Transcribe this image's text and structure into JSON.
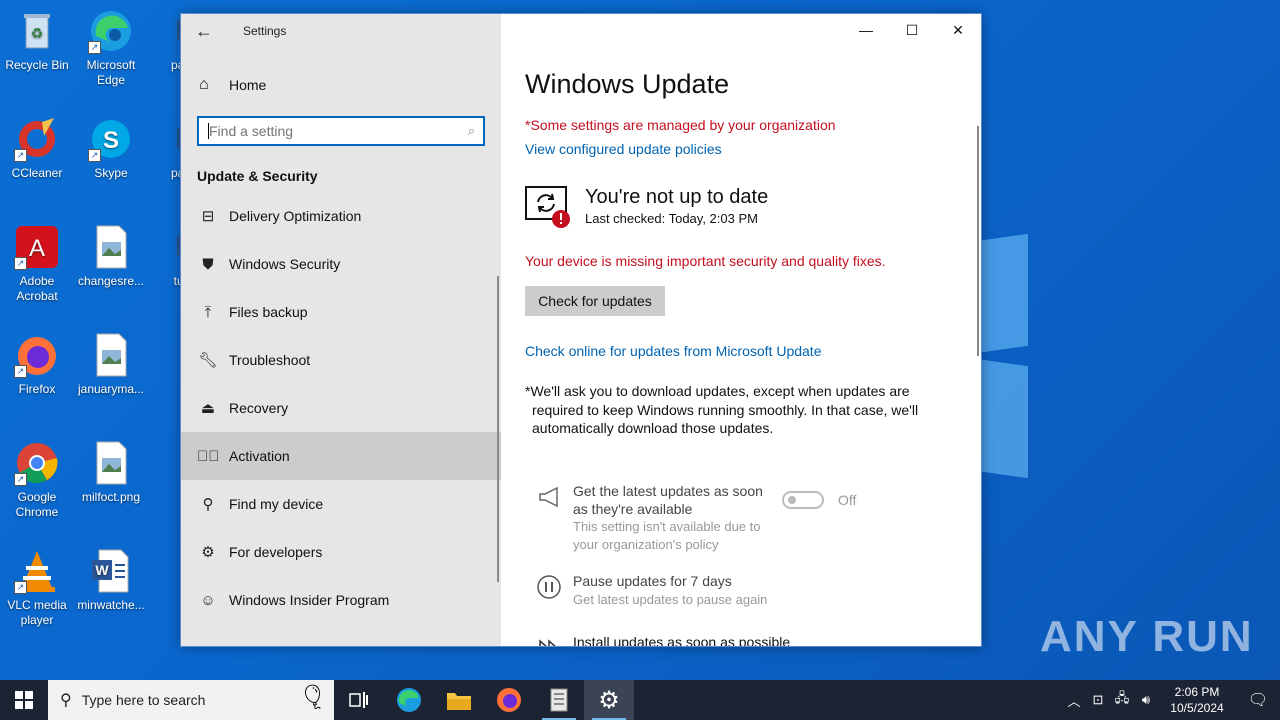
{
  "desktop": {
    "icons": [
      {
        "label": "Recycle Bin"
      },
      {
        "label": "Microsoft Edge"
      },
      {
        "label": "palm"
      },
      {
        "label": "CCleaner"
      },
      {
        "label": "Skype"
      },
      {
        "label": "patie"
      },
      {
        "label": "Adobe Acrobat"
      },
      {
        "label": "changesre..."
      },
      {
        "label": "turn"
      },
      {
        "label": "Firefox"
      },
      {
        "label": "januaryma..."
      },
      {
        "label": "Google Chrome"
      },
      {
        "label": "milfoct.png"
      },
      {
        "label": "VLC media player"
      },
      {
        "label": "minwatche..."
      }
    ],
    "watermark": "ANY RUN"
  },
  "window": {
    "title": "Settings",
    "nav": {
      "home_label": "Home",
      "search_placeholder": "Find a setting",
      "section_title": "Update & Security",
      "items": [
        {
          "label": "Delivery Optimization",
          "icon": "delivery-icon"
        },
        {
          "label": "Windows Security",
          "icon": "shield-icon"
        },
        {
          "label": "Files backup",
          "icon": "backup-icon"
        },
        {
          "label": "Troubleshoot",
          "icon": "wrench-icon"
        },
        {
          "label": "Recovery",
          "icon": "recovery-icon"
        },
        {
          "label": "Activation",
          "icon": "check-circle-icon",
          "selected": true
        },
        {
          "label": "Find my device",
          "icon": "person-pin-icon"
        },
        {
          "label": "For developers",
          "icon": "developer-icon"
        },
        {
          "label": "Windows Insider Program",
          "icon": "insider-icon"
        }
      ]
    },
    "content": {
      "title": "Windows Update",
      "managed_notice": "*Some settings are managed by your organization",
      "view_policies_link": "View configured update policies",
      "status_title": "You're not up to date",
      "status_last_checked": "Last checked: Today, 2:03 PM",
      "warning": "Your device is missing important security and quality fixes.",
      "check_button": "Check for updates",
      "online_link": "Check online for updates from Microsoft Update",
      "note_line1": "*We'll ask you to download updates, except when updates are",
      "note_line2": "required to keep Windows running smoothly. In that case, we'll",
      "note_line3": "automatically download those updates.",
      "option_latest_title_1": "Get the latest updates as soon",
      "option_latest_title_2": "as they're available",
      "option_latest_sub_1": "This setting isn't available due to",
      "option_latest_sub_2": "your organization's policy",
      "toggle_state": "Off",
      "option_pause_title": "Pause updates for 7 days",
      "option_pause_sub": "Get latest updates to pause again",
      "option_install_title": "Install updates as soon as possible"
    }
  },
  "taskbar": {
    "search_placeholder": "Type here to search",
    "time": "2:06 PM",
    "date": "10/5/2024"
  },
  "colors": {
    "accent": "#0067c0",
    "error": "#c50f1f",
    "link": "#0063b1"
  }
}
